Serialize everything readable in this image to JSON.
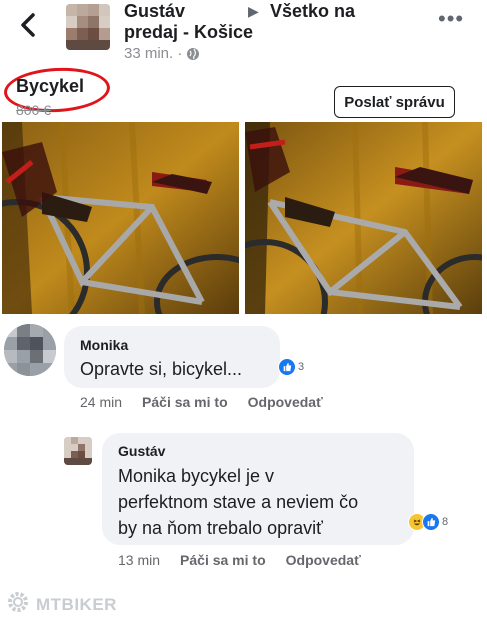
{
  "header": {
    "author": "Gustáv",
    "group_line1": "Všetko na",
    "group_line2": "predaj - Košice",
    "time": "33 min. ·",
    "arrow": "▶",
    "more": "•••"
  },
  "listing": {
    "title": "Bycykel",
    "price": "800 €",
    "send_button": "Poslať správu"
  },
  "comments": [
    {
      "author": "Monika",
      "text": "Opravte si, bicykel...",
      "reaction_count": "3",
      "time": "24 min",
      "like": "Páči sa mi to",
      "reply": "Odpovedať"
    },
    {
      "author": "Gustáv",
      "text_lines": [
        "Monika bycykel je v",
        "perfektnom stave a neviem čo",
        "by na ňom trebalo opraviť"
      ],
      "reaction_count": "8",
      "time": "13 min",
      "like": "Páči sa mi to",
      "reply": "Odpovedať"
    }
  ],
  "watermark": "MTBIKER",
  "colors": {
    "highlight_ring": "#e1141b",
    "like_blue": "#1877f2",
    "bubble": "#f0f2f5"
  }
}
